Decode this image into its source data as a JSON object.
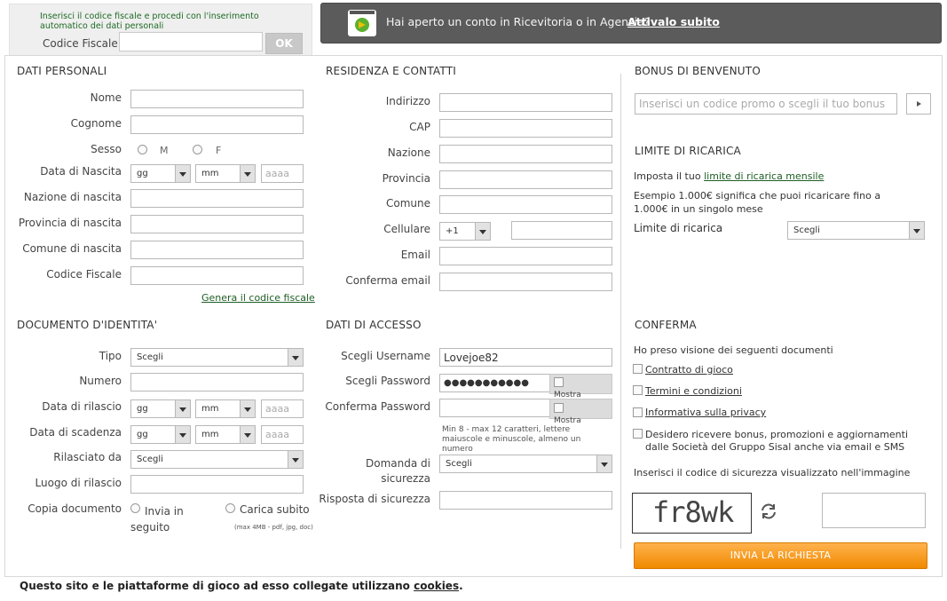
{
  "top": {
    "info": "Inserisci il codice fiscale e procedi con l'inserimento automatico dei dati personali",
    "codice_label": "Codice Fiscale",
    "ok": "OK"
  },
  "banner": {
    "text": "Hai aperto un conto in Ricevitoria o in Agenzia?",
    "link": "Attivalo subito"
  },
  "personali": {
    "title": "DATI PERSONALI",
    "nome": "Nome",
    "cognome": "Cognome",
    "sesso": "Sesso",
    "m": "M",
    "f": "F",
    "nascita": "Data di Nascita",
    "gg": "gg",
    "mm": "mm",
    "aaaa": "aaaa",
    "nazione_nascita": "Nazione di nascita",
    "provincia_nascita": "Provincia di nascita",
    "comune_nascita": "Comune di nascita",
    "codice_fiscale": "Codice Fiscale",
    "genera": "Genera il codice fiscale"
  },
  "residenza": {
    "title": "RESIDENZA E CONTATTI",
    "indirizzo": "Indirizzo",
    "cap": "CAP",
    "nazione": "Nazione",
    "provincia": "Provincia",
    "comune": "Comune",
    "cellulare": "Cellulare",
    "prefix": "+1",
    "email": "Email",
    "conferma_email": "Conferma email"
  },
  "bonus": {
    "title": "BONUS DI BENVENUTO",
    "placeholder": "Inserisci un codice promo o scegli il tuo bonus"
  },
  "limite": {
    "title": "LIMITE DI RICARICA",
    "line1_pre": "Imposta il tuo ",
    "line1_link": "limite di ricarica mensile",
    "line2": "Esempio 1.000€ significa che puoi ricaricare fino a 1.000€ in un singolo mese",
    "label": "Limite di ricarica",
    "select": "Scegli"
  },
  "documento": {
    "title": "DOCUMENTO D'IDENTITA'",
    "tipo": "Tipo",
    "tipo_sel": "Scegli",
    "numero": "Numero",
    "rilascio": "Data di rilascio",
    "scadenza": "Data di scadenza",
    "gg": "gg",
    "mm": "mm",
    "aaaa": "aaaa",
    "rilasciato": "Rilasciato da",
    "rilasciato_sel": "Scegli",
    "luogo": "Luogo di rilascio",
    "copia": "Copia documento",
    "invia": "Invia in seguito",
    "carica": "Carica subito",
    "maxsize": "(max 4MB - pdf, jpg, doc)"
  },
  "accesso": {
    "title": "DATI DI ACCESSO",
    "username": "Scegli Username",
    "username_val": "Lovejoe82",
    "password": "Scegli Password",
    "password_val": "●●●●●●●●●●●",
    "conferma": "Conferma Password",
    "mostra": "Mostra",
    "hint": "Min 8 - max 12 caratteri, lettere maiuscole e minuscole, almeno un numero",
    "domanda": "Domanda di sicurezza",
    "domanda_sel": "Scegli",
    "risposta": "Risposta di sicurezza"
  },
  "conferma": {
    "title": "CONFERMA",
    "intro": "Ho preso visione dei seguenti documenti",
    "contratto": "Contratto di gioco",
    "termini": "Termini e condizioni",
    "privacy": "Informativa sulla privacy",
    "desidero": "Desidero ricevere bonus, promozioni e aggiornamenti dalle Società del Gruppo Sisal anche via email e SMS",
    "captcha_intro": "Inserisci il codice di sicurezza visualizzato nell'immagine",
    "captcha": "fr8wk",
    "submit": "INVIA LA RICHIESTA"
  },
  "footer": {
    "pre": "Questo sito e le piattaforme di gioco ad esso collegate utilizzano ",
    "link": "cookies",
    "post": "."
  },
  "colors": {
    "accent": "#f08a00",
    "link": "#1d5e24",
    "banner": "#5b5b5b"
  }
}
